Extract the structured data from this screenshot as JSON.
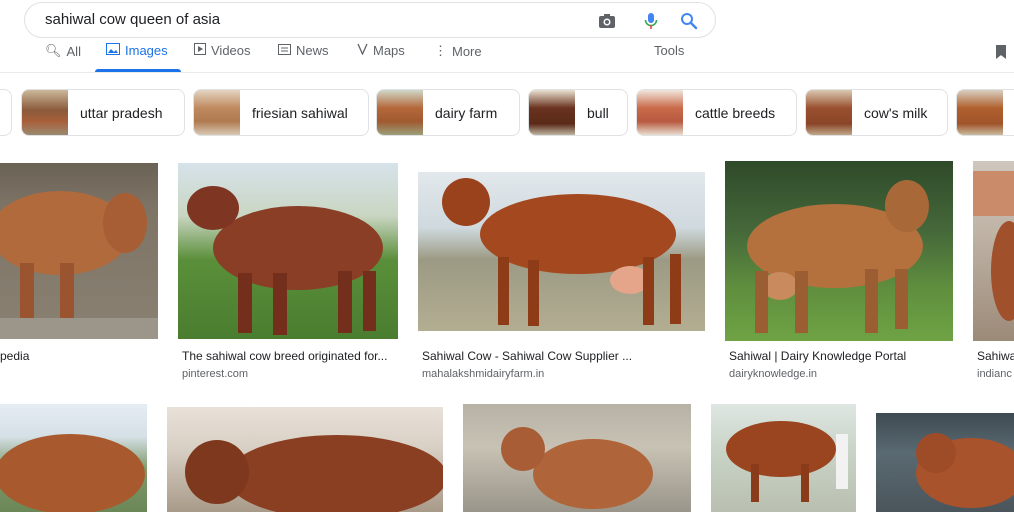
{
  "search": {
    "query": "sahiwal cow queen of asia"
  },
  "tabs": {
    "all": "All",
    "images": "Images",
    "videos": "Videos",
    "news": "News",
    "maps": "Maps",
    "more": "More",
    "tools": "Tools"
  },
  "chips": [
    "uttar pradesh",
    "friesian sahiwal",
    "dairy farm",
    "bull",
    "cattle breeds",
    "cow's milk"
  ],
  "results": [
    {
      "caption": "pedia",
      "source": ""
    },
    {
      "caption": "The sahiwal cow breed originated for...",
      "source": "pinterest.com"
    },
    {
      "caption": "Sahiwal Cow - Sahiwal Cow Supplier ...",
      "source": "mahalakshmidairyfarm.in"
    },
    {
      "caption": "Sahiwal | Dairy Knowledge Portal",
      "source": "dairyknowledge.in"
    },
    {
      "caption": "Sahiwa",
      "source": "indianc"
    }
  ],
  "colors": {
    "accent": "#1a73e8",
    "cow": "#a0522d",
    "grass": "#5a8f3a",
    "sky": "#dfe8ee"
  }
}
